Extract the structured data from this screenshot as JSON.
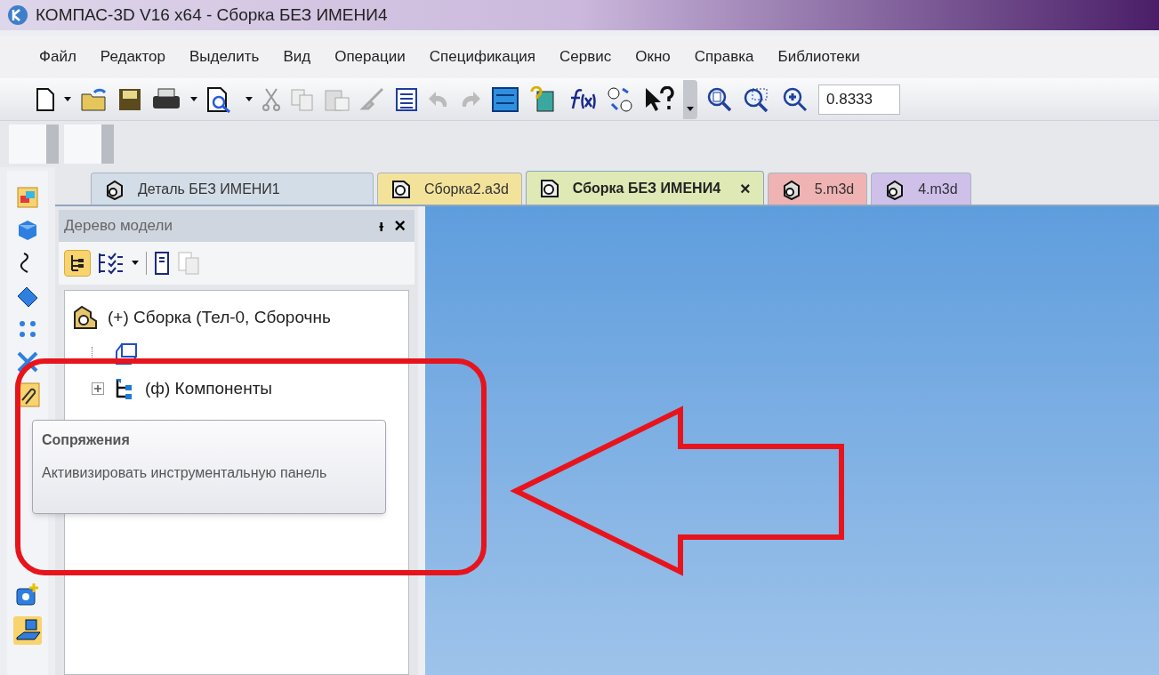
{
  "window": {
    "title": "КОМПАС-3D V16  x64 - Сборка БЕЗ ИМЕНИ4"
  },
  "menu": [
    "Файл",
    "Редактор",
    "Выделить",
    "Вид",
    "Операции",
    "Спецификация",
    "Сервис",
    "Окно",
    "Справка",
    "Библиотеки"
  ],
  "zoom_field": {
    "value": "0.8333"
  },
  "tabs": [
    {
      "label": "Деталь БЕЗ ИМЕНИ1",
      "kind": "part",
      "color": "#d3dde8",
      "selected": false
    },
    {
      "label": "Сборка2.a3d",
      "kind": "assembly",
      "color": "#f3e39a",
      "selected": false
    },
    {
      "label": "Сборка БЕЗ ИМЕНИ4",
      "kind": "assembly",
      "color": "#dfe9b5",
      "selected": true,
      "close": "×"
    },
    {
      "label": "5.m3d",
      "kind": "part",
      "color": "#efb3b3",
      "selected": false
    },
    {
      "label": "4.m3d",
      "kind": "part",
      "color": "#cfc0ea",
      "selected": false
    }
  ],
  "tree_panel": {
    "title": "Дерево модели",
    "pin": "ᵼ",
    "close": "×",
    "tree": [
      {
        "label": "(+) Сборка (Тел-0, Сборочнь",
        "kind": "assembly",
        "expanded": true,
        "children": [
          {
            "kind": "coordinate-system"
          },
          {
            "label": "(ф) Компоненты",
            "kind": "components",
            "expanded": false
          }
        ]
      }
    ]
  },
  "tooltip": {
    "title": "Сопряжения",
    "text": "Активизировать инструментальную панель"
  }
}
